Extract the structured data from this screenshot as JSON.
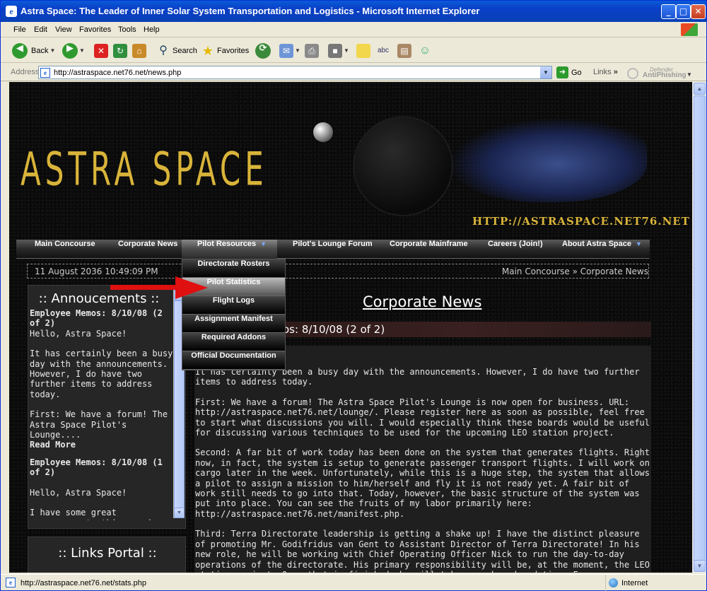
{
  "window": {
    "title": "Astra Space: The Leader of Inner Solar System Transportation and Logistics - Microsoft Internet Explorer",
    "btn_min": "_",
    "btn_max": "□",
    "btn_close": "✕"
  },
  "menu": [
    "File",
    "Edit",
    "View",
    "Favorites",
    "Tools",
    "Help"
  ],
  "toolbar": {
    "back": "Back",
    "search": "Search",
    "favorites": "Favorites"
  },
  "address": {
    "label": "Address",
    "url": "http://astraspace.net76.net/news.php",
    "go": "Go",
    "links": "Links",
    "antiphishing_top": "Defender",
    "antiphishing": "AntiPhishing"
  },
  "site": {
    "logo": "ASTRA SPACE",
    "url": "HTTP://ASTRASPACE.NET76.NET"
  },
  "nav": [
    {
      "label": "Main Concourse"
    },
    {
      "label": "Corporate News"
    },
    {
      "label": "Pilot Resources"
    },
    {
      "label": "Pilot's Lounge Forum"
    },
    {
      "label": "Corporate Mainframe"
    },
    {
      "label": "Careers (Join!)"
    },
    {
      "label": "About Astra Space"
    }
  ],
  "dropdown": [
    "Directorate Rosters",
    "Pilot Statistics",
    "Flight Logs",
    "Assignment Manifest",
    "Required Addons",
    "Official Documentation"
  ],
  "datebar": {
    "date": "11 August 2036 10:49:09 PM",
    "breadcrumb": "Main Concourse » Corporate News"
  },
  "announcements": {
    "title": ":: Annoucements ::",
    "items": [
      {
        "title": "Employee Memos: 8/10/08 (2 of 2)",
        "p1": "Hello, Astra Space!",
        "p2": "It has certainly been a busy day with the announcements. However, I do have two further items to address today.",
        "p3": "First: We have a forum! The Astra Space Pilot's Lounge....",
        "more": "Read More"
      },
      {
        "title": "Employee Memos: 8/10/08 (1 of 2)",
        "p1": "Hello, Astra Space!",
        "p2": "I have some great announcements this morning. I will first start out with the most"
      }
    ]
  },
  "links_portal": {
    "title": ":: Links Portal ::"
  },
  "main": {
    "page_title": "Corporate News",
    "post_title": "os: 8/10/08 (2 of 2)",
    "paragraphs": [
      "It has certainly been a busy day with the announcements. However, I do have two further items to address today.",
      "First: We have a forum! The Astra Space Pilot's Lounge is now open for business. URL: http://astraspace.net76.net/lounge/. Please register here as soon as possible, feel free to start what discussions you will. I would especially think these boards would be useful for discussing various techniques to be used for the upcoming LEO station project.",
      "Second: A far bit of work today has been done on the system that generates flights. Right now, in fact, the system is setup to generate passenger transport flights. I will work on cargo later in the week. Unfortunately, while this is a huge step, the system that allows a pilot to assign a mission to him/herself and fly it is not ready yet. A fair bit of work still needs to go into that. Today, however, the basic structure of the system was put into place. You can see the fruits of my labor primarily here: http://astraspace.net76.net/manifest.php.",
      "Third: Terra Directorate leadership is getting a shake up! I have the distinct pleasure of promoting Mr. Godifridus van Gent to Assistant Director of Terra Directorate! In his new role, he will be working with Chief Operating Officer Nick to run the day-to-day operations of the directorate. His primary responsibility will be, at the moment, the LEO station project. Once that is finished, he will take over broader duties. Everyone, please congratulate him, I assure you, it is most deserved."
    ]
  },
  "status": {
    "url": "http://astraspace.net76.net/stats.php",
    "zone": "Internet"
  }
}
